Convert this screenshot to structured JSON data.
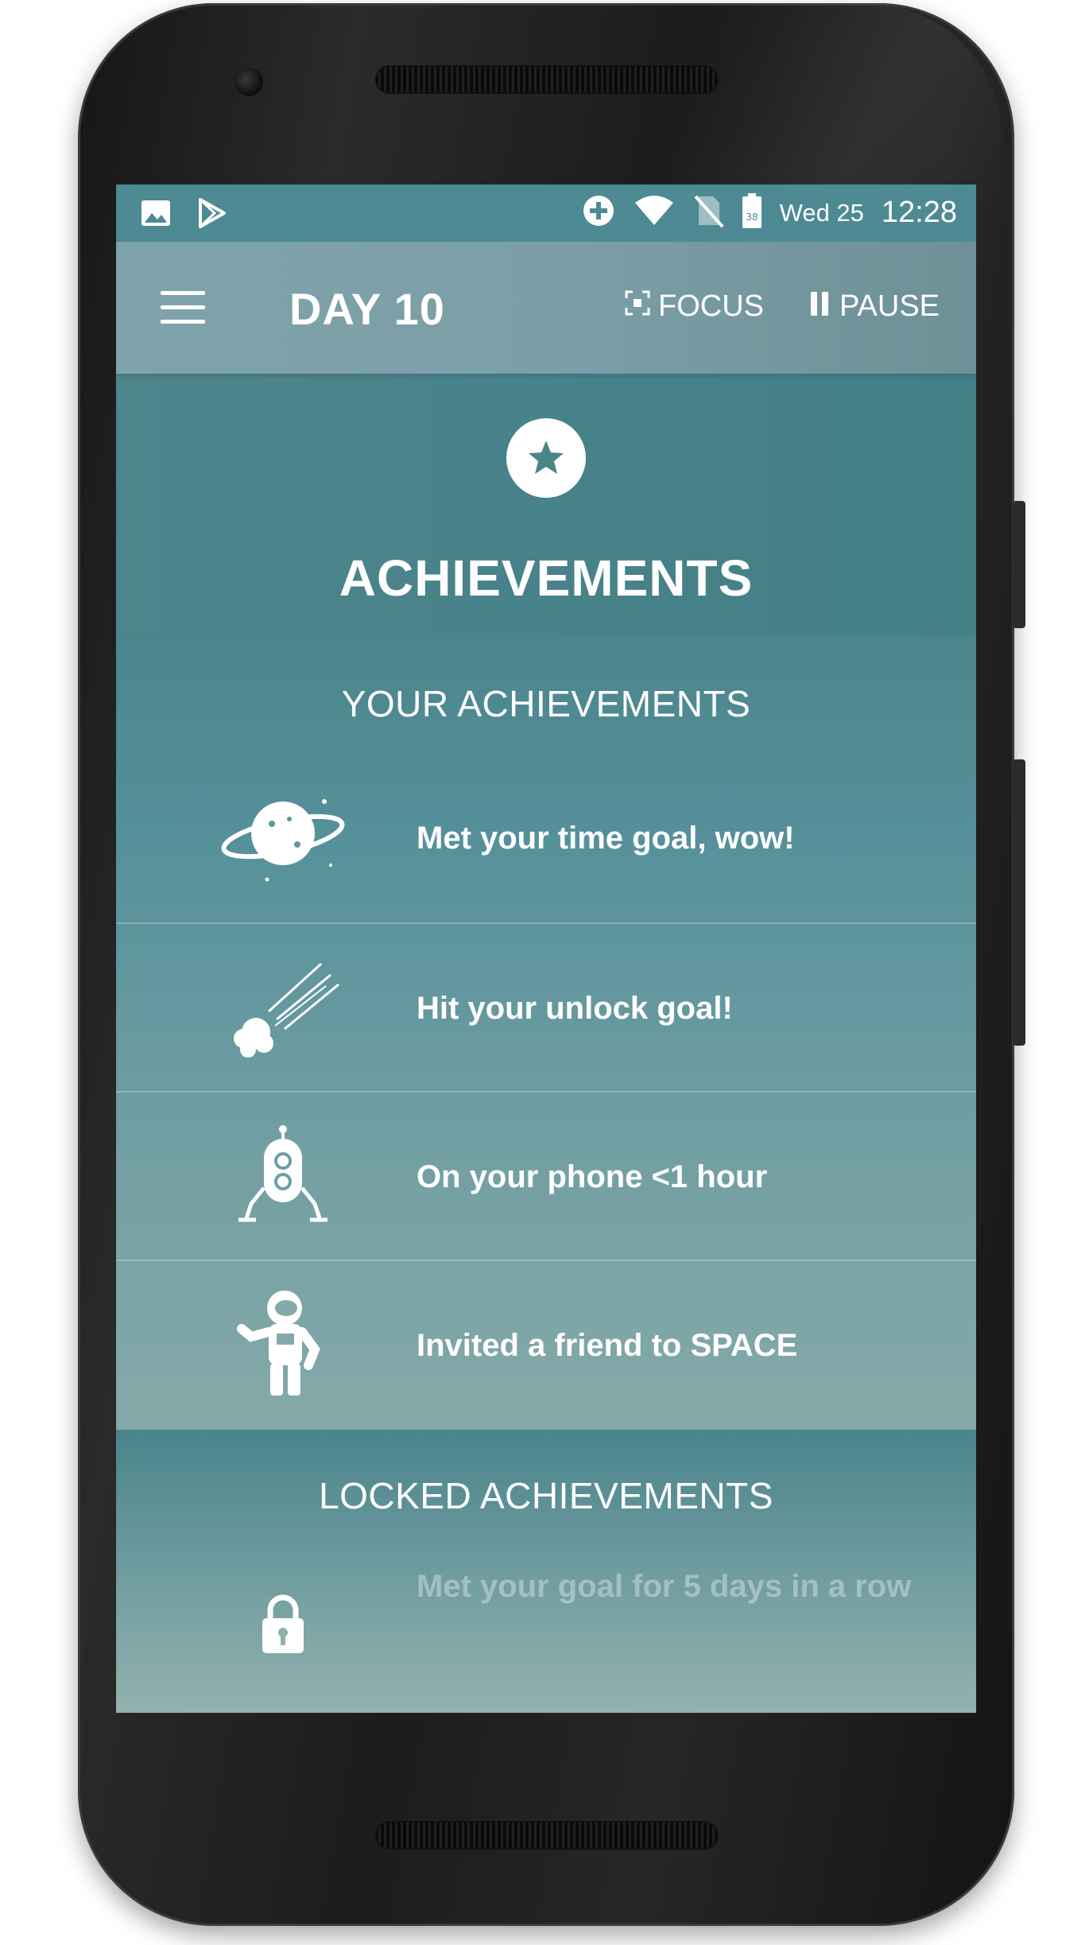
{
  "status_bar": {
    "date": "Wed 25",
    "time": "12:28",
    "battery_level": "38"
  },
  "app_bar": {
    "title": "DAY 10",
    "focus_label": "FOCUS",
    "pause_label": "PAUSE"
  },
  "hero": {
    "title": "ACHIEVEMENTS"
  },
  "your_achievements": {
    "header": "YOUR ACHIEVEMENTS",
    "items": [
      {
        "icon": "planet-icon",
        "label": "Met your time goal, wow!"
      },
      {
        "icon": "comet-icon",
        "label": "Hit your unlock goal!"
      },
      {
        "icon": "robot-icon",
        "label": "On your phone <1 hour"
      },
      {
        "icon": "astronaut-icon",
        "label": "Invited a friend to SPACE"
      }
    ]
  },
  "locked_achievements": {
    "header": "LOCKED ACHIEVEMENTS",
    "items": [
      {
        "icon": "lock-icon",
        "label": "Met your goal for 5 days in a row"
      }
    ]
  },
  "colors": {
    "accent_teal": "#4b858c",
    "appbar": "#7ea2aa",
    "text": "#ffffff"
  }
}
